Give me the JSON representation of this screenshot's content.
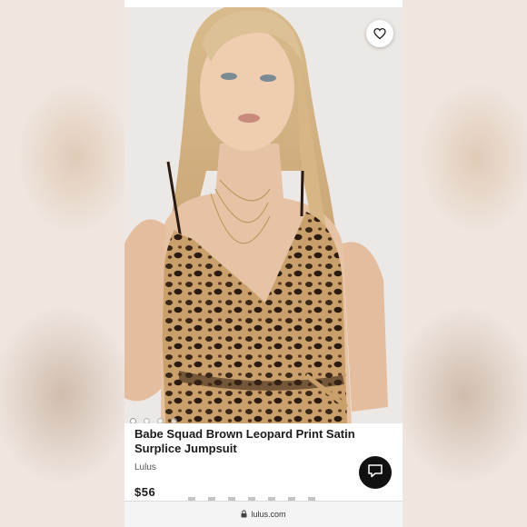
{
  "product": {
    "title": "Babe Squad Brown Leopard Print Satin Surplice Jumpsuit",
    "brand": "Lulus",
    "price": "$56"
  },
  "carousel": {
    "count": 4,
    "active_index": 0
  },
  "browser": {
    "url": "lulus.com"
  },
  "icons": {
    "favorite": "heart-icon",
    "chat": "chat-icon",
    "lock": "lock-icon"
  },
  "colors": {
    "chat_button": "#111111",
    "text": "#1a1a1a"
  }
}
